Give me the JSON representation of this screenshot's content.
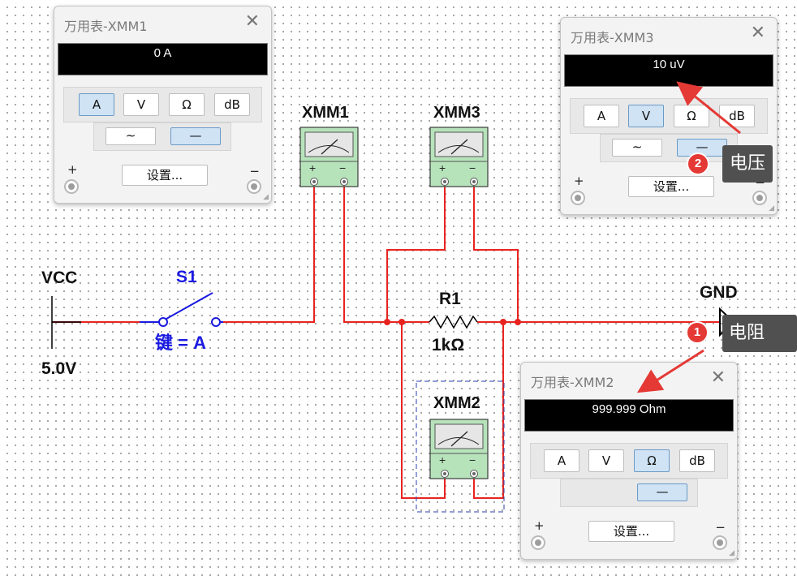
{
  "circuit": {
    "vcc_label": "VCC",
    "vcc_voltage": "5.0V",
    "switch_name": "S1",
    "switch_key": "键 = A",
    "resistor_name": "R1",
    "resistor_value": "1kΩ",
    "gnd_label": "GND",
    "meters": [
      {
        "name": "XMM1"
      },
      {
        "name": "XMM3"
      },
      {
        "name": "XMM2"
      }
    ],
    "plus_sign": "+",
    "minus_sign": "−",
    "colors": {
      "wire": "#e8231f",
      "switch": "#1a1ae0",
      "meter_body": "#b7e3bb",
      "selection": "#2a3fb0"
    }
  },
  "panels": {
    "xmm1": {
      "title": "万用表-XMM1",
      "display": "0 A",
      "active_mode": "A",
      "active_coupling": "dc"
    },
    "xmm3": {
      "title": "万用表-XMM3",
      "display": "10 uV",
      "active_mode": "V",
      "active_coupling": "dc"
    },
    "xmm2": {
      "title": "万用表-XMM2",
      "display": "999.999 Ohm",
      "active_mode": "Ω",
      "active_coupling": "dc"
    }
  },
  "panel_controls": {
    "modes": [
      "A",
      "V",
      "Ω",
      "dB"
    ],
    "ac_symbol": "∼",
    "dc_symbol": "—",
    "settings_label": "设置...",
    "plus": "+",
    "minus": "−",
    "close": "✕"
  },
  "annotations": [
    {
      "number": "1",
      "text": "电阻"
    },
    {
      "number": "2",
      "text": "电压"
    }
  ]
}
